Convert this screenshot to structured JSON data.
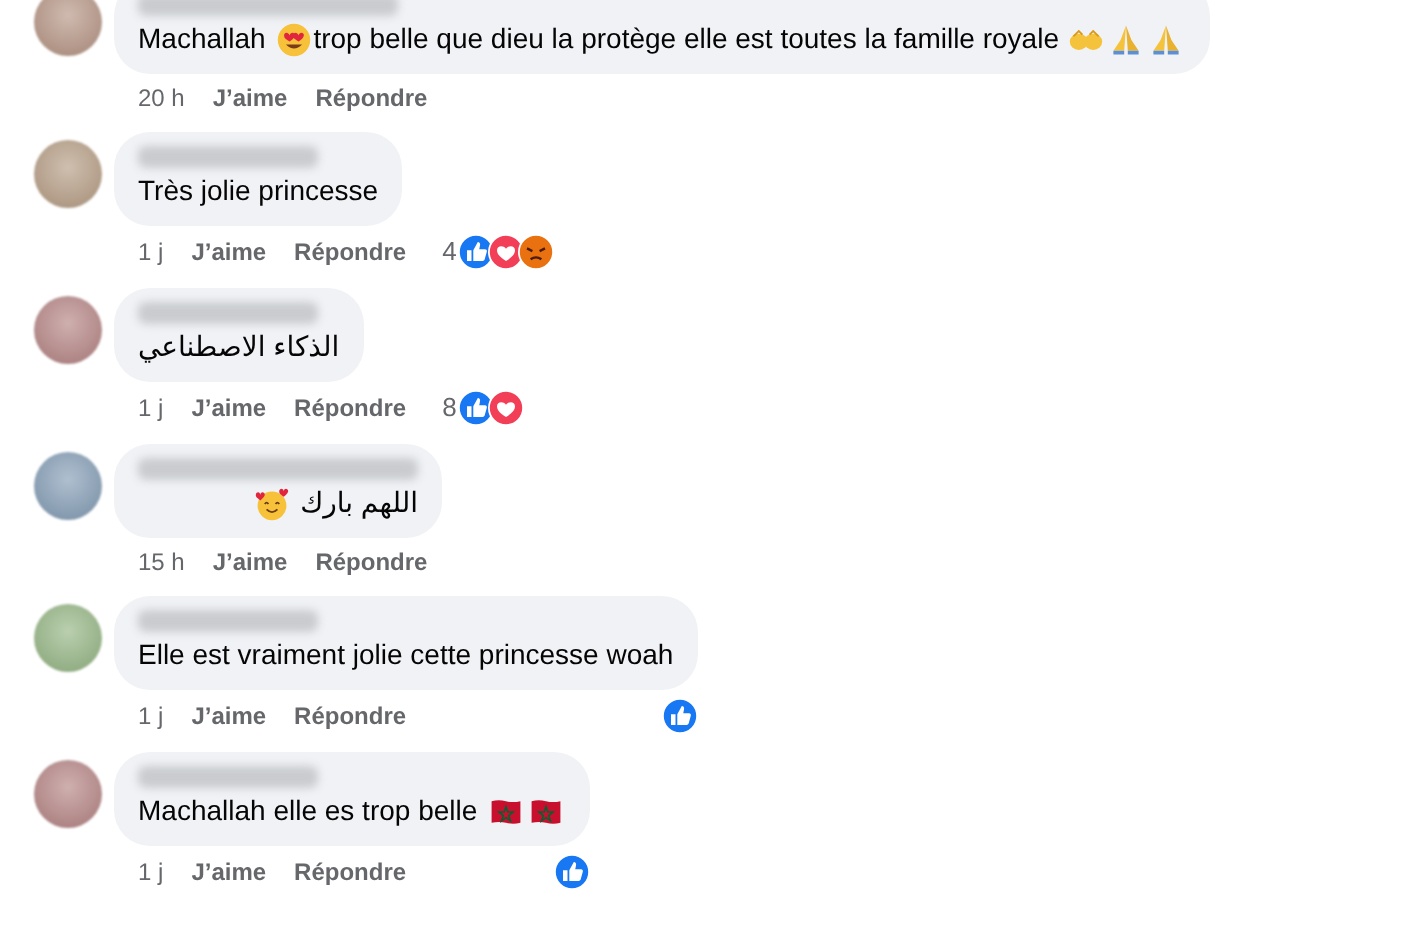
{
  "comments": [
    {
      "message": [
        {
          "kind": "text",
          "text": "Machallah "
        },
        {
          "kind": "heart-eyes"
        },
        {
          "kind": "text",
          "text": "trop belle que dieu la protège elle est toutes la famille royale "
        },
        {
          "kind": "open-hands"
        },
        {
          "kind": "praying-hands"
        },
        {
          "kind": "praying-hands"
        }
      ],
      "time": "20 h",
      "like": "J’aime",
      "reply": "Répondre"
    },
    {
      "message": [
        {
          "kind": "text",
          "text": "Très jolie princesse"
        }
      ],
      "time": "1 j",
      "like": "J’aime",
      "reply": "Répondre",
      "reaction_count": "4",
      "reactions": [
        {
          "kind": "like"
        },
        {
          "kind": "love"
        },
        {
          "kind": "angry"
        }
      ]
    },
    {
      "message": [
        {
          "kind": "text",
          "text": "الذكاء الاصطناعي"
        }
      ],
      "time": "1 j",
      "like": "J’aime",
      "reply": "Répondre",
      "reaction_count": "8",
      "reactions": [
        {
          "kind": "like"
        },
        {
          "kind": "love"
        }
      ]
    },
    {
      "message": [
        {
          "kind": "text",
          "text": "اللهم بارك "
        },
        {
          "kind": "smiling-hearts"
        }
      ],
      "time": "15 h",
      "like": "J’aime",
      "reply": "Répondre"
    },
    {
      "message": [
        {
          "kind": "text",
          "text": "Elle est vraiment jolie cette princesse woah"
        }
      ],
      "time": "1 j",
      "like": "J’aime",
      "reply": "Répondre",
      "reactions": [
        {
          "kind": "like"
        }
      ]
    },
    {
      "message": [
        {
          "kind": "text",
          "text": "Machallah elle es trop belle "
        },
        {
          "kind": "flag"
        },
        {
          "kind": "flag"
        }
      ],
      "time": "1 j",
      "like": "J’aime",
      "reply": "Répondre",
      "reactions": [
        {
          "kind": "like"
        }
      ]
    }
  ]
}
